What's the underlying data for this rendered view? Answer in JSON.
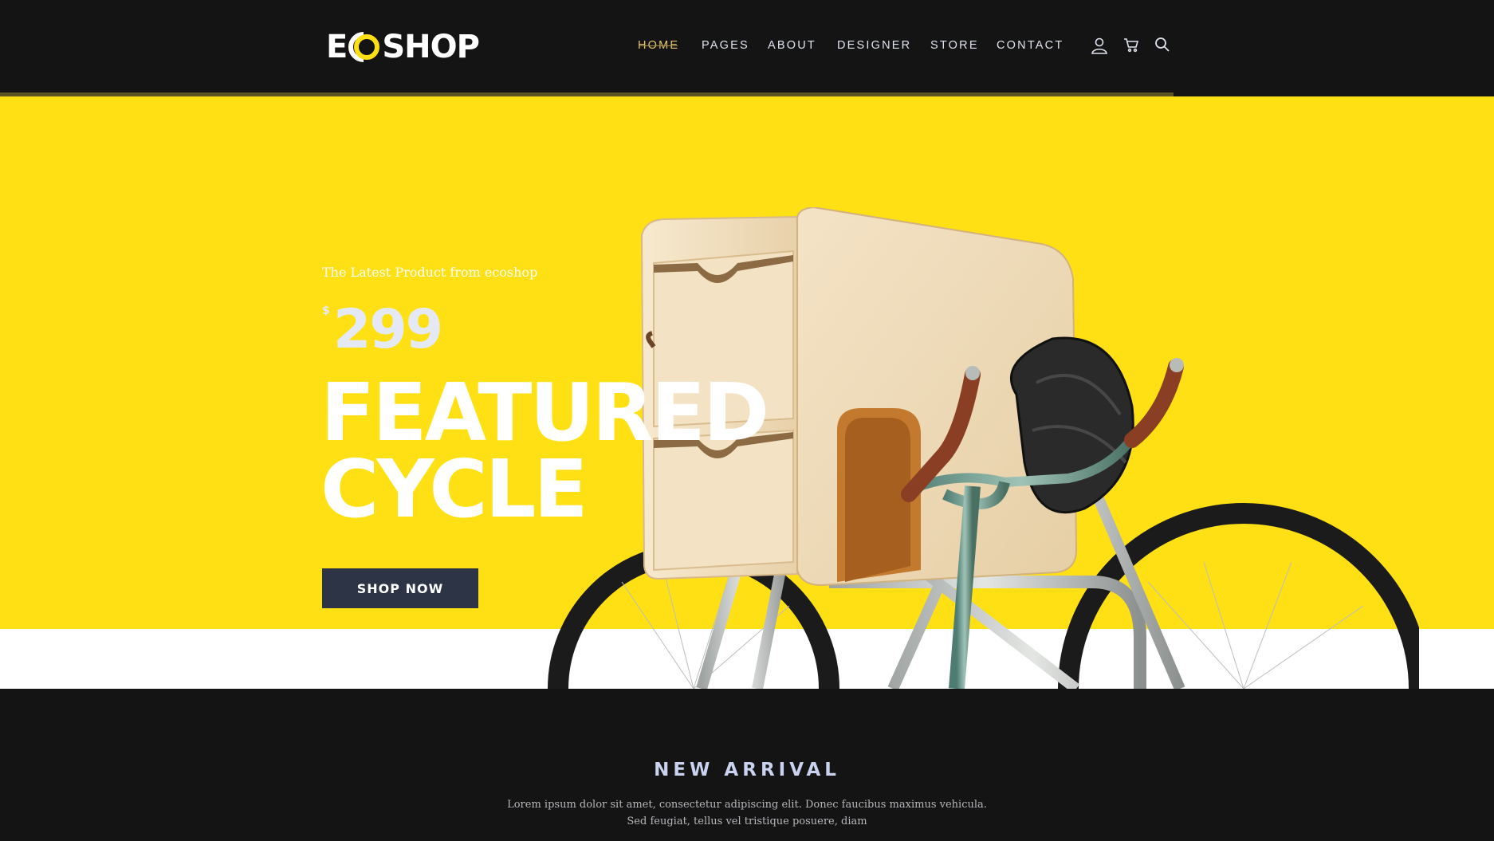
{
  "brand": {
    "logo_pre": "E",
    "logo_post": "SHOP",
    "accent": "#ffe014",
    "dark": "#141414",
    "button_bg": "#2c3445"
  },
  "nav": {
    "items": [
      {
        "label": "HOME",
        "active": true
      },
      {
        "label": "PAGES"
      },
      {
        "label": "ABOUT"
      },
      {
        "label": "DESIGNER"
      },
      {
        "label": "STORE"
      },
      {
        "label": "CONTACT"
      }
    ],
    "icons": [
      "user-icon",
      "cart-icon",
      "search-icon"
    ]
  },
  "hero": {
    "tagline": "The Latest Product from ecoshop",
    "currency": "$",
    "price": "299",
    "headline_line1": "FEATURED",
    "headline_line2": "CYCLE",
    "cta": "SHOP NOW"
  },
  "arrivals": {
    "title": "NEW ARRIVAL",
    "text_line1": "Lorem ipsum dolor sit amet, consectetur adipiscing elit. Donec faucibus maximus vehicula.",
    "text_line2": "Sed feugiat, tellus vel tristique posuere, diam"
  }
}
